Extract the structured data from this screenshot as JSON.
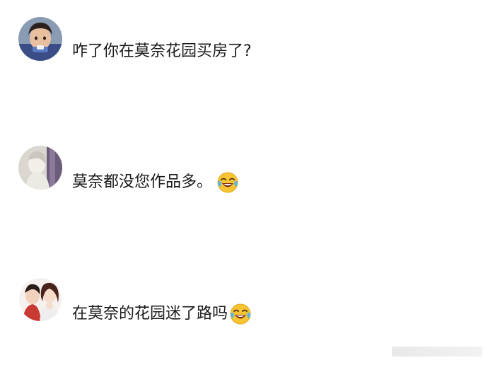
{
  "comments": [
    {
      "text": "咋了你在莫奈花园买房了?",
      "emoji": null,
      "avatar": "child-photo-avatar"
    },
    {
      "text": "莫奈都没您作品多。",
      "emoji": "laughing-crying-emoji",
      "avatar": "pale-figure-avatar"
    },
    {
      "text": "在莫奈的花园迷了路吗",
      "emoji": "laughing-crying-emoji",
      "avatar": "cartoon-couple-avatar"
    }
  ],
  "colors": {
    "text": "#1a1a1a",
    "background": "#ffffff",
    "emoji_face": "#f7c531"
  }
}
